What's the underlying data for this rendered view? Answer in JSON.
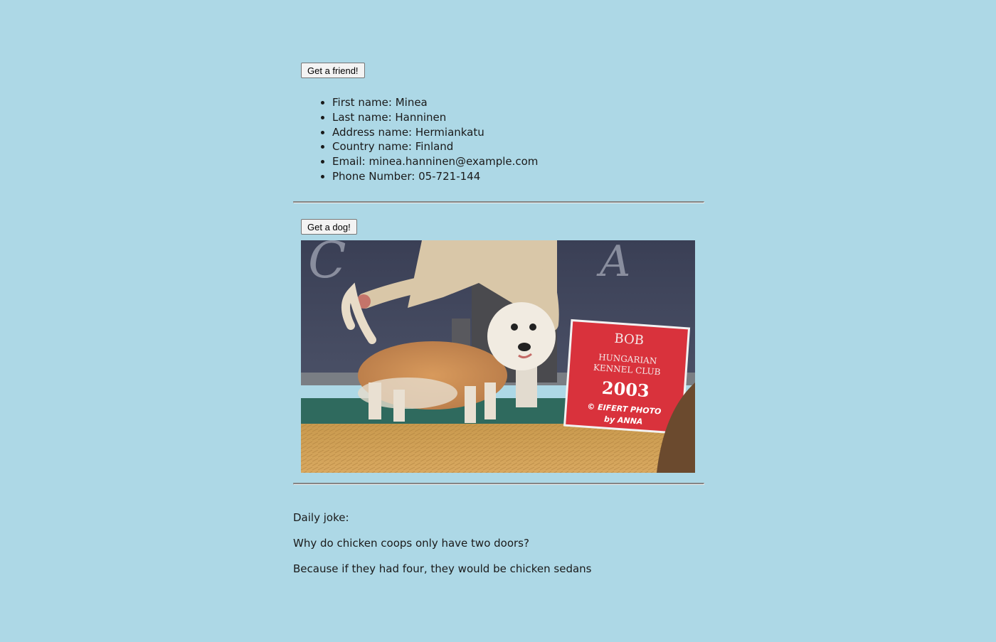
{
  "friend_section": {
    "button_label": "Get a friend!",
    "details": [
      {
        "label": "First name",
        "value": "Minea"
      },
      {
        "label": "Last name",
        "value": "Hanninen"
      },
      {
        "label": "Address name",
        "value": "Hermiankatu"
      },
      {
        "label": "Country name",
        "value": "Finland"
      },
      {
        "label": "Email",
        "value": "minea.hanninen@example.com"
      },
      {
        "label": "Phone Number",
        "value": "05-721-144"
      }
    ]
  },
  "dog_section": {
    "button_label": "Get a dog!",
    "photo_sign": {
      "line1": "BOB",
      "line2": "HUNGARIAN",
      "line3": "KENNEL CLUB",
      "year": "2003",
      "credit1": "© EIFERT PHOTO",
      "credit2": "by ANNA"
    }
  },
  "joke_section": {
    "label": "Daily joke:",
    "question": "Why do chicken coops only have two doors?",
    "answer": "Because if they had four, they would be chicken sedans"
  },
  "colors": {
    "page_background": "#add8e6",
    "divider": "#858585",
    "sign_red": "#d9323c"
  }
}
